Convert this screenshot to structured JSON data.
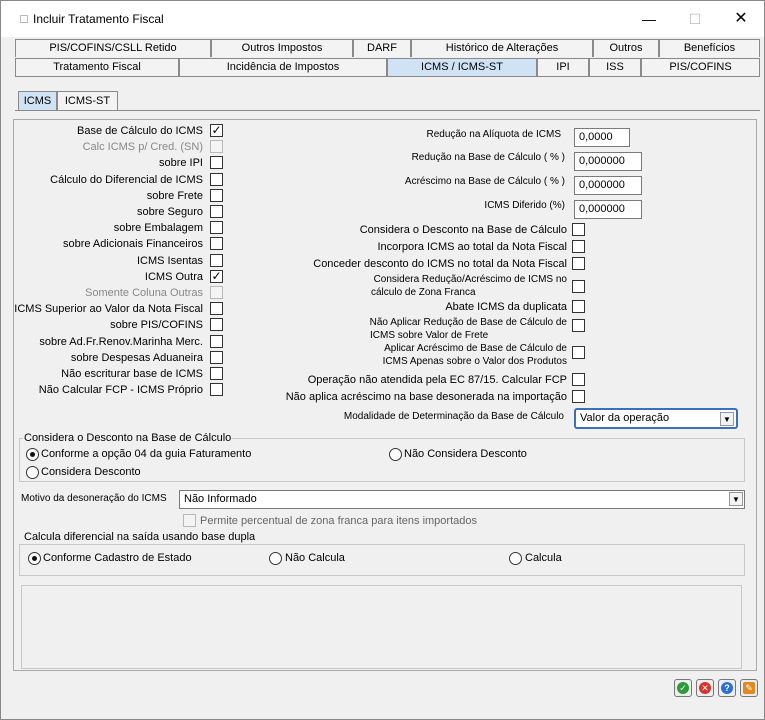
{
  "window": {
    "title": "Incluir Tratamento Fiscal",
    "minimize": "—",
    "maximize": "☐",
    "close": "✕"
  },
  "tabs_row1": [
    "PIS/COFINS/CSLL Retido",
    "Outros Impostos",
    "DARF",
    "Histórico de Alterações",
    "Outros",
    "Benefícios"
  ],
  "tabs_row2": [
    "Tratamento Fiscal",
    "Incidência de Impostos",
    "ICMS / ICMS-ST",
    "IPI",
    "ISS",
    "PIS/COFINS"
  ],
  "active_tab": "ICMS / ICMS-ST",
  "subtabs": [
    "ICMS",
    "ICMS-ST"
  ],
  "active_subtab": "ICMS",
  "left_options": [
    {
      "label": "Base de Cálculo do ICMS",
      "checked": true,
      "disabled": false
    },
    {
      "label": "Calc ICMS p/ Cred. (SN)",
      "checked": false,
      "disabled": true
    },
    {
      "label": "sobre IPI",
      "checked": false,
      "disabled": false
    },
    {
      "label": "Cálculo do Diferencial de ICMS",
      "checked": false,
      "disabled": false
    },
    {
      "label": "sobre Frete",
      "checked": false,
      "disabled": false
    },
    {
      "label": "sobre Seguro",
      "checked": false,
      "disabled": false
    },
    {
      "label": "sobre Embalagem",
      "checked": false,
      "disabled": false
    },
    {
      "label": "sobre Adicionais Financeiros",
      "checked": false,
      "disabled": false
    },
    {
      "label": "ICMS Isentas",
      "checked": false,
      "disabled": false
    },
    {
      "label": "ICMS Outra",
      "checked": true,
      "disabled": false
    },
    {
      "label": "Somente Coluna Outras",
      "checked": false,
      "disabled": true
    },
    {
      "label": "ICMS Superior ao Valor da Nota Fiscal",
      "checked": false,
      "disabled": false
    },
    {
      "label": "sobre PIS/COFINS",
      "checked": false,
      "disabled": false
    },
    {
      "label": "sobre Ad.Fr.Renov.Marinha Merc.",
      "checked": false,
      "disabled": false
    },
    {
      "label": "sobre Despesas Aduaneira",
      "checked": false,
      "disabled": false
    },
    {
      "label": "Não escriturar base de ICMS",
      "checked": false,
      "disabled": false
    },
    {
      "label": "Não Calcular FCP - ICMS Próprio",
      "checked": false,
      "disabled": false
    }
  ],
  "right_fields": [
    {
      "label": "Redução na Alíquota de ICMS",
      "value": "0,0000"
    },
    {
      "label": "Redução na Base de Cálculo ( % )",
      "value": "0,000000"
    },
    {
      "label": "Acréscimo na Base de Cálculo ( % )",
      "value": "0,000000"
    },
    {
      "label": "ICMS Diferido (%)",
      "value": "0,000000"
    }
  ],
  "right_options": [
    {
      "label": "Considera o Desconto na Base de Cálculo"
    },
    {
      "label": "Incorpora ICMS ao total da Nota Fiscal"
    },
    {
      "label": "Conceder desconto do ICMS no total da Nota Fiscal"
    },
    {
      "label": "Considera Redução/Acréscimo de ICMS no",
      "label2": "cálculo de Zona Franca"
    },
    {
      "label": "Abate ICMS da duplicata"
    },
    {
      "label": "Não Aplicar Redução de Base de Cálculo de",
      "label2": "ICMS sobre Valor de Frete"
    },
    {
      "label": "Aplicar Acréscimo de Base de Cálculo de",
      "label2": "ICMS Apenas sobre o Valor dos Produtos"
    },
    {
      "label": "Operação não atendida pela EC 87/15. Calcular FCP"
    },
    {
      "label": "Não aplica acréscimo na base desonerada na importação"
    }
  ],
  "modalidade": {
    "label": "Modalidade de Determinação da Base de Cálculo",
    "value": "Valor da operação"
  },
  "desconto_group": {
    "title": "Considera o Desconto na Base de Cálculo",
    "opt1": "Conforme a opção 04 da guia Faturamento",
    "opt2": "Não Considera Desconto",
    "opt3": "Considera Desconto"
  },
  "motivo": {
    "label": "Motivo da desoneração do ICMS",
    "value": "Não Informado"
  },
  "zona_franca_label": "Permite percentual de zona franca para itens importados",
  "diferencial_group": {
    "title": "Calcula diferencial na saída usando base dupla",
    "opt1": "Conforme Cadastro de Estado",
    "opt2": "Não Calcula",
    "opt3": "Calcula"
  },
  "colors": {
    "tab_active": "#cfe3f5",
    "ok": "#2e9b3a",
    "cancel": "#d6342c",
    "help": "#2c6fd1",
    "tool": "#e08a1e"
  },
  "action_buttons": [
    "ok-icon",
    "cancel-icon",
    "help-icon",
    "wrench-icon"
  ]
}
